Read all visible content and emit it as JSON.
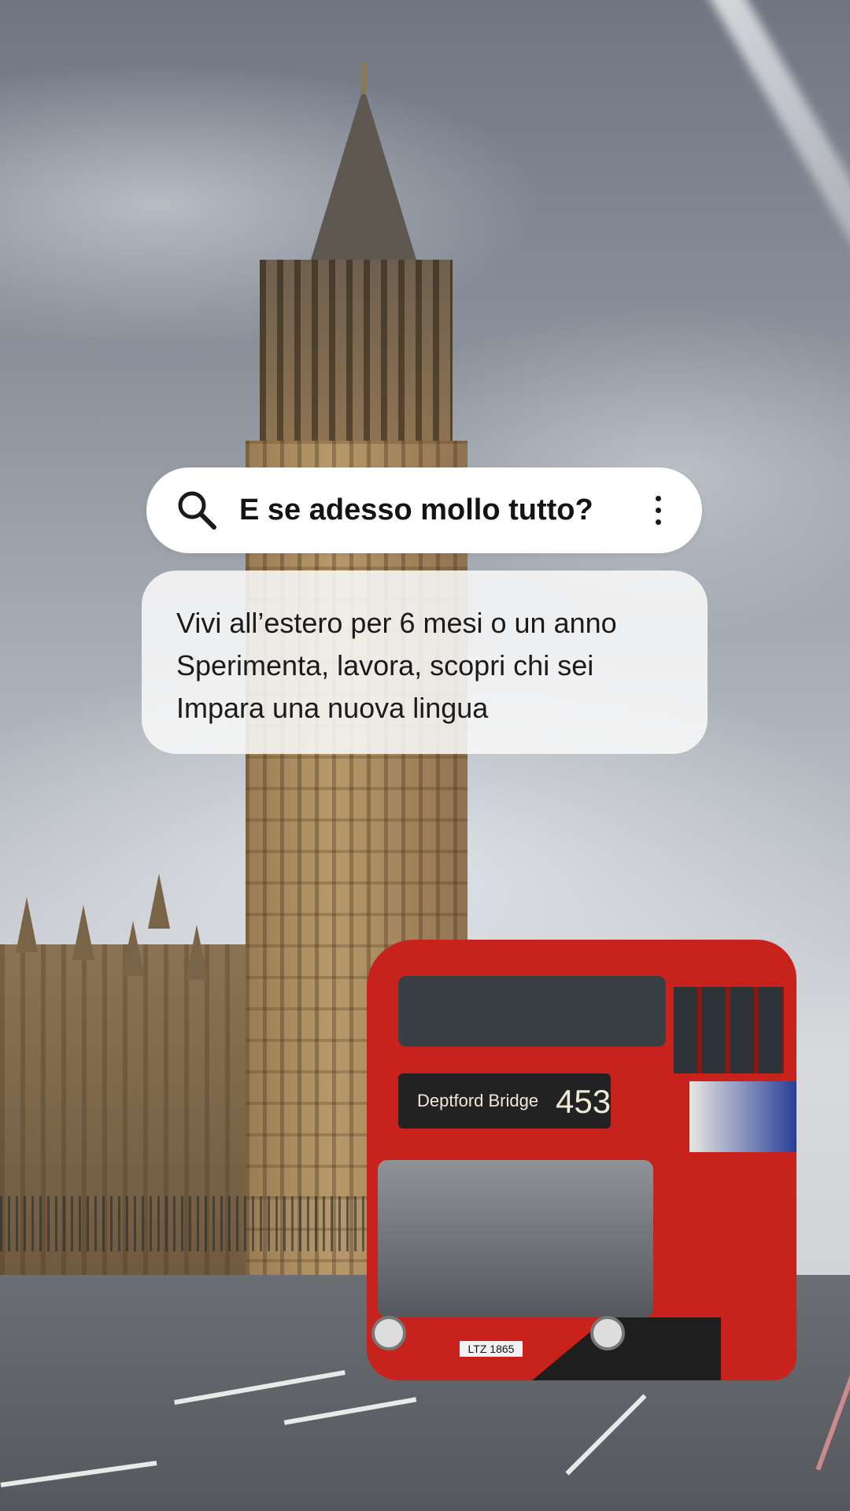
{
  "search": {
    "query": "E se adesso mollo tutto?",
    "icon": "search-icon",
    "menu_icon": "more-vertical-icon"
  },
  "suggestions": [
    "Vivi all’estero per 6 mesi o un anno",
    "Sperimenta, lavora, scopri chi sei",
    "Impara una nuova lingua"
  ],
  "background": {
    "bus_destination": "Deptford Bridge",
    "bus_route": "453",
    "bus_plate": "LTZ 1865"
  }
}
